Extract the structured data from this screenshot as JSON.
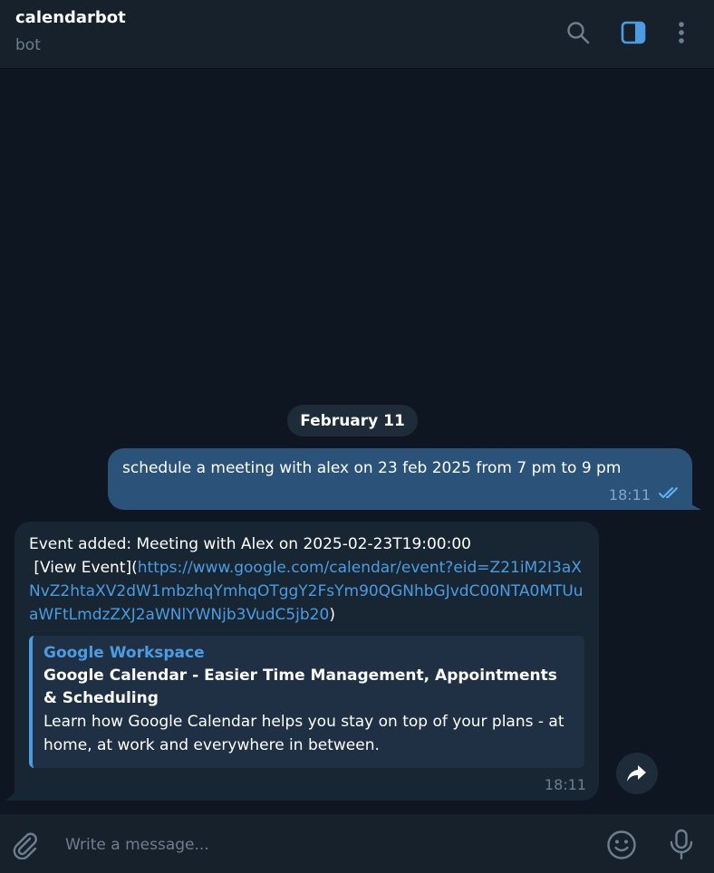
{
  "header": {
    "title": "calendarbot",
    "subtitle": "bot",
    "icons": [
      "search-icon",
      "sidebar-toggle-icon",
      "more-vertical-icon"
    ]
  },
  "date_separator": "February 11",
  "messages": {
    "outgoing": {
      "text": "schedule a meeting with alex on 23 feb 2025 from 7 pm to 9 pm",
      "time": "18:11",
      "status": "read"
    },
    "incoming": {
      "line1": "Event added: Meeting with Alex on 2025-02-23T19:00:00",
      "prefix": " [View Event](",
      "link": "https://www.google.com/calendar/event?eid=Z21iM2I3aXNvZ2htaXV2dW1mbzhqYmhqOTggY2FsYm90QGNhbGJvdC00NTA0MTUuaWFtLmdzZXJ2aWNlYWNjb3VudC5jb20",
      "suffix": ")",
      "preview": {
        "site": "Google Workspace",
        "title": "Google Calendar - Easier Time Management, Appointments & Scheduling",
        "description": "Learn how Google Calendar helps you stay on top of your plans - at home, at work and everywhere in between."
      },
      "time": "18:11"
    }
  },
  "composer": {
    "placeholder": "Write a message..."
  },
  "colors": {
    "background": "#0e1621",
    "header": "#17212b",
    "outgoing_bubble": "#2b5278",
    "incoming_bubble": "#182533",
    "accent": "#4c9ce2"
  }
}
